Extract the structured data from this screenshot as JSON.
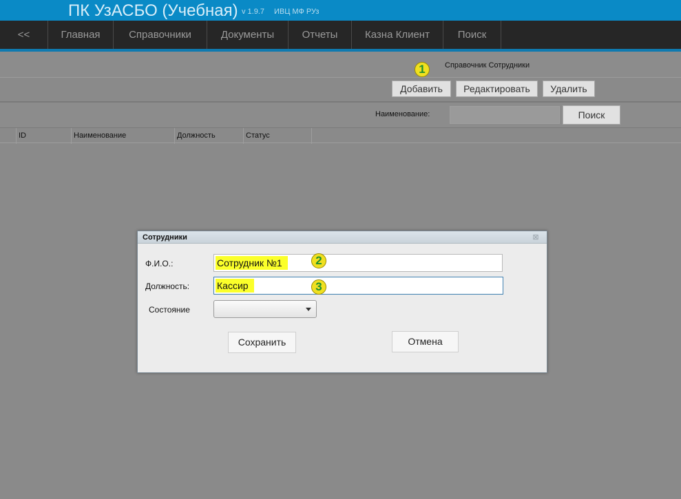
{
  "app": {
    "title": "ПК УзАСБО (Учебная)",
    "version": "v 1.9.7",
    "org": "ИВЦ МФ РУз"
  },
  "menu": {
    "items": [
      {
        "label": "<<"
      },
      {
        "label": "Главная"
      },
      {
        "label": "Справочники"
      },
      {
        "label": "Документы"
      },
      {
        "label": "Отчеты"
      },
      {
        "label": "Казна Клиент"
      },
      {
        "label": "Поиск"
      }
    ]
  },
  "page": {
    "title": "Справочник Сотрудники",
    "badges": [
      "1",
      "2",
      "3"
    ]
  },
  "toolbar": {
    "add_label": "Добавить",
    "edit_label": "Редактировать",
    "delete_label": "Удалить"
  },
  "search": {
    "label": "Наименование:",
    "value": "",
    "button_label": "Поиск"
  },
  "grid": {
    "columns": [
      "ID",
      "Наименование",
      "Должность",
      "Статус"
    ]
  },
  "dialog": {
    "title": "Сотрудники",
    "close_glyph": "⊠",
    "fio_label": "Ф.И.О.:",
    "fio_value": "Сотрудник №1",
    "position_label": "Должность:",
    "position_value": "Кассир",
    "state_label": "Состояние",
    "state_value": "",
    "save_label": "Сохранить",
    "cancel_label": "Отмена"
  },
  "colors": {
    "titlebar": "#0a8ac6",
    "menubar": "#262626",
    "accent": "#0f7ab0",
    "highlight": "#fbff2a",
    "badge": "#f0e020",
    "badge_text": "#1f8f2f"
  }
}
